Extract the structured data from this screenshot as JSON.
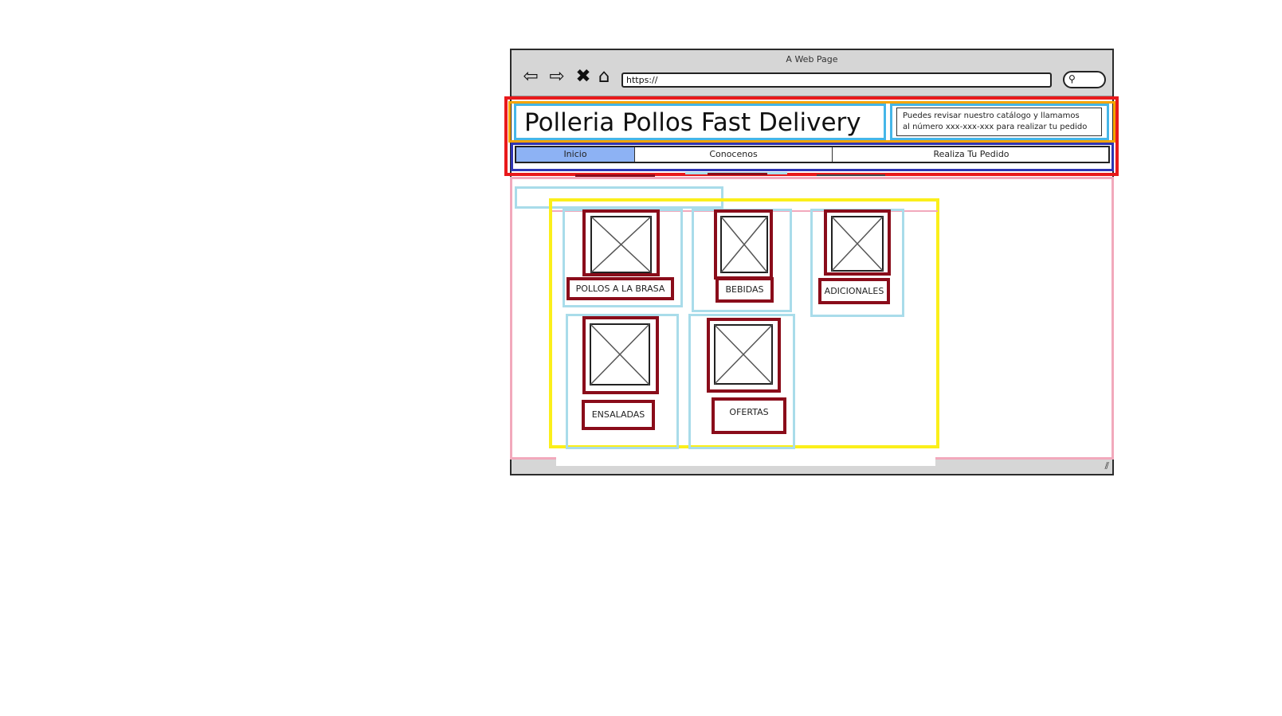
{
  "window": {
    "title": "A Web Page",
    "url": "https://",
    "nav_icons": [
      "back-arrow-icon",
      "forward-arrow-icon",
      "stop-x-icon",
      "home-icon"
    ]
  },
  "header": {
    "title": "Polleria Pollos Fast Delivery",
    "info_line1": "Puedes revisar nuestro catálogo y llamamos",
    "info_line2": "al número xxx-xxx-xxx para realizar tu pedido"
  },
  "nav": {
    "tabs": [
      {
        "label": "Inicio",
        "active": true
      },
      {
        "label": "Conocenos",
        "active": false
      },
      {
        "label": "Realiza Tu Pedido",
        "active": false
      }
    ]
  },
  "catalog": {
    "items": [
      {
        "label": "POLLOS A LA BRASA"
      },
      {
        "label": "BEBIDAS"
      },
      {
        "label": "ADICIONALES"
      },
      {
        "label": "ENSALADAS"
      },
      {
        "label": "OFERTAS"
      }
    ]
  },
  "colors": {
    "header_outline": "#e8191b",
    "header_inner_outline": "#f6a400",
    "title_outline": "#45b6e8",
    "nav_outline": "#2f34b3",
    "active_tab": "#8db2f4",
    "content_outline": "#f2a9bc",
    "grid_outline": "#fbef1a",
    "item_outline": "#8a0c1a",
    "cell_outline": "#a9dcea"
  }
}
